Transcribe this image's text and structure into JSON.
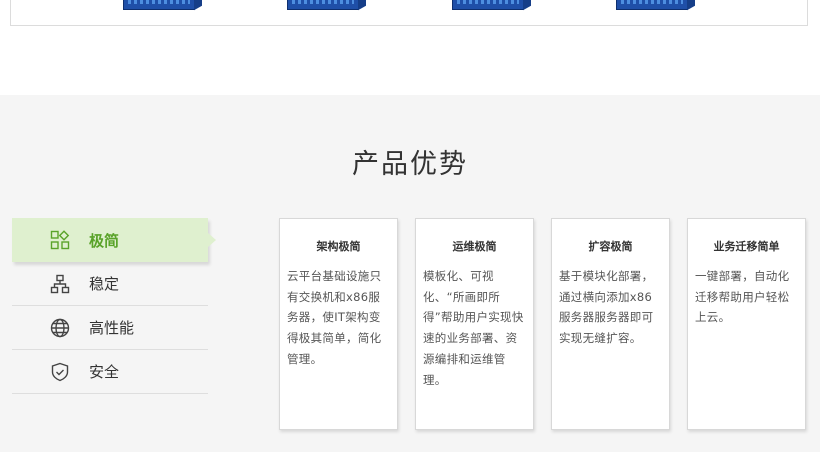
{
  "section": {
    "title": "产品优势"
  },
  "nav": {
    "items": [
      {
        "label": "极简",
        "icon": "apps-grid-icon",
        "active": true
      },
      {
        "label": "稳定",
        "icon": "network-tree-icon",
        "active": false
      },
      {
        "label": "高性能",
        "icon": "globe-icon",
        "active": false
      },
      {
        "label": "安全",
        "icon": "shield-check-icon",
        "active": false
      }
    ]
  },
  "cards": [
    {
      "title": "架构极简",
      "text": "云平台基础设施只有交换机和x86服务器，使IT架构变得极其简单，简化管理。"
    },
    {
      "title": "运维极简",
      "text": "模板化、可视化、“所画即所得”帮助用户实现快速的业务部署、资源编排和运维管理。"
    },
    {
      "title": "扩容极简",
      "text": "基于模块化部署，通过横向添加x86服务器服务器即可实现无缝扩容。"
    },
    {
      "title": "业务迁移简单",
      "text": "一键部署，自动化迁移帮助用户轻松上云。"
    }
  ],
  "colors": {
    "accent": "#5aa32a",
    "active_bg": "#dff0cf",
    "section_bg": "#f5f5f5"
  }
}
